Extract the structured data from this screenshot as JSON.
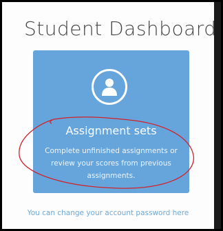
{
  "header": {
    "title": "Student Dashboard"
  },
  "card": {
    "icon": "user-icon",
    "title": "Assignment sets",
    "description": "Complete unfinished assignments or review your scores from previous assignments.",
    "color": "#66a5dc"
  },
  "footer": {
    "password_link": "You can change your account password here"
  },
  "annotation": {
    "color": "#d0232a"
  }
}
